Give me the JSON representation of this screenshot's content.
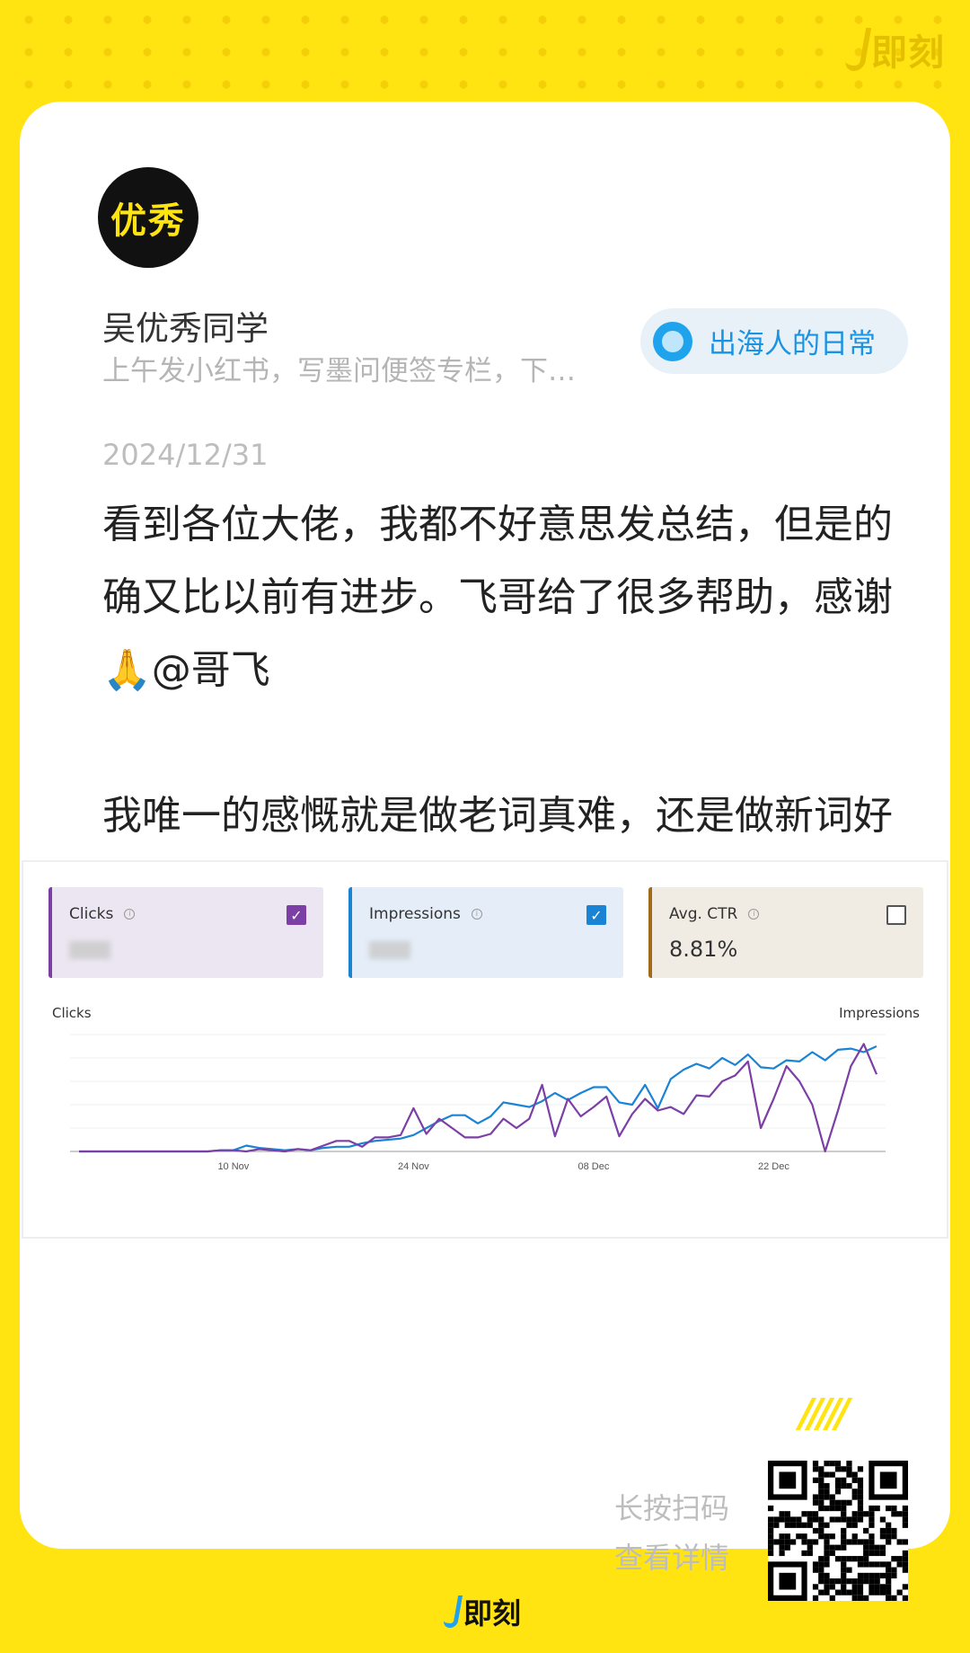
{
  "brand": {
    "name": "即刻",
    "accent": "#FFE411",
    "logo_accent": "#1fa3ec"
  },
  "user": {
    "avatar_text": "优秀",
    "name": "吴优秀同学",
    "bio": "上午发小红书，写墨问便签专栏，下午..."
  },
  "topic": {
    "label": "出海人的日常",
    "icon": "circle-dot-icon"
  },
  "post": {
    "date": "2024/12/31",
    "paragraph1": "看到各位大佬，我都不好意思发总结，但是的确又比以前有进步。飞哥给了很多帮助，感谢🙏@哥飞",
    "paragraph2": "我唯一的感慨就是做老词真难，还是做新词好🥲"
  },
  "screenshot": {
    "metrics": [
      {
        "label": "Clicks",
        "value": "",
        "checked": true,
        "color": "#7b3fa6"
      },
      {
        "label": "Impressions",
        "value": "",
        "checked": true,
        "color": "#1a83d4"
      },
      {
        "label": "Avg. CTR",
        "value": "8.81%",
        "checked": false,
        "color": "#a06c1a"
      }
    ],
    "left_axis_title": "Clicks",
    "right_axis_title": "Impressions"
  },
  "chart_data": {
    "type": "line",
    "title": "",
    "xlabel": "",
    "ylabel": "Clicks",
    "y2label": "Impressions",
    "x_tick_labels": [
      "10 Nov",
      "24 Nov",
      "08 Dec",
      "22 Dec"
    ],
    "x": [
      "29 Oct",
      "30 Oct",
      "31 Oct",
      "01 Nov",
      "02 Nov",
      "03 Nov",
      "04 Nov",
      "05 Nov",
      "06 Nov",
      "07 Nov",
      "08 Nov",
      "09 Nov",
      "10 Nov",
      "11 Nov",
      "12 Nov",
      "13 Nov",
      "14 Nov",
      "15 Nov",
      "16 Nov",
      "17 Nov",
      "18 Nov",
      "19 Nov",
      "20 Nov",
      "21 Nov",
      "22 Nov",
      "23 Nov",
      "24 Nov",
      "25 Nov",
      "26 Nov",
      "27 Nov",
      "28 Nov",
      "29 Nov",
      "30 Nov",
      "01 Dec",
      "02 Dec",
      "03 Dec",
      "04 Dec",
      "05 Dec",
      "06 Dec",
      "07 Dec",
      "08 Dec",
      "09 Dec",
      "10 Dec",
      "11 Dec",
      "12 Dec",
      "13 Dec",
      "14 Dec",
      "15 Dec",
      "16 Dec",
      "17 Dec",
      "18 Dec",
      "19 Dec",
      "20 Dec",
      "21 Dec",
      "22 Dec",
      "23 Dec",
      "24 Dec",
      "25 Dec",
      "26 Dec",
      "27 Dec",
      "28 Dec",
      "29 Dec",
      "30 Dec"
    ],
    "ylim": [
      0,
      100
    ],
    "grid": true,
    "legend": "none",
    "series": [
      {
        "color": "#1a83d4",
        "axis": "right",
        "values": [
          0,
          0,
          0,
          0,
          0,
          0,
          0,
          0,
          0,
          0,
          0,
          1,
          1,
          5,
          3,
          2,
          1,
          2,
          1,
          3,
          4,
          4,
          7,
          9,
          10,
          11,
          14,
          20,
          26,
          31,
          31,
          24,
          30,
          42,
          40,
          38,
          43,
          50,
          44,
          50,
          55,
          55,
          42,
          40,
          57,
          37,
          62,
          70,
          75,
          71,
          80,
          74,
          83,
          72,
          71,
          78,
          77,
          85,
          78,
          87,
          88,
          85,
          90
        ]
      },
      {
        "color": "#7b3fa6",
        "axis": "left",
        "values": [
          0,
          0,
          0,
          0,
          0,
          0,
          0,
          0,
          0,
          0,
          0,
          1,
          1,
          0,
          2,
          1,
          0,
          2,
          1,
          5,
          9,
          9,
          4,
          12,
          12,
          14,
          37,
          15,
          28,
          20,
          12,
          12,
          15,
          28,
          20,
          28,
          57,
          13,
          45,
          30,
          38,
          47,
          13,
          32,
          45,
          35,
          38,
          32,
          48,
          47,
          60,
          65,
          77,
          20,
          45,
          73,
          60,
          40,
          0,
          35,
          73,
          92,
          66
        ]
      }
    ]
  },
  "cta": {
    "slashes": "/////",
    "line1": "长按扫码",
    "line2": "查看详情",
    "qr_icon": "qr-code-icon"
  }
}
